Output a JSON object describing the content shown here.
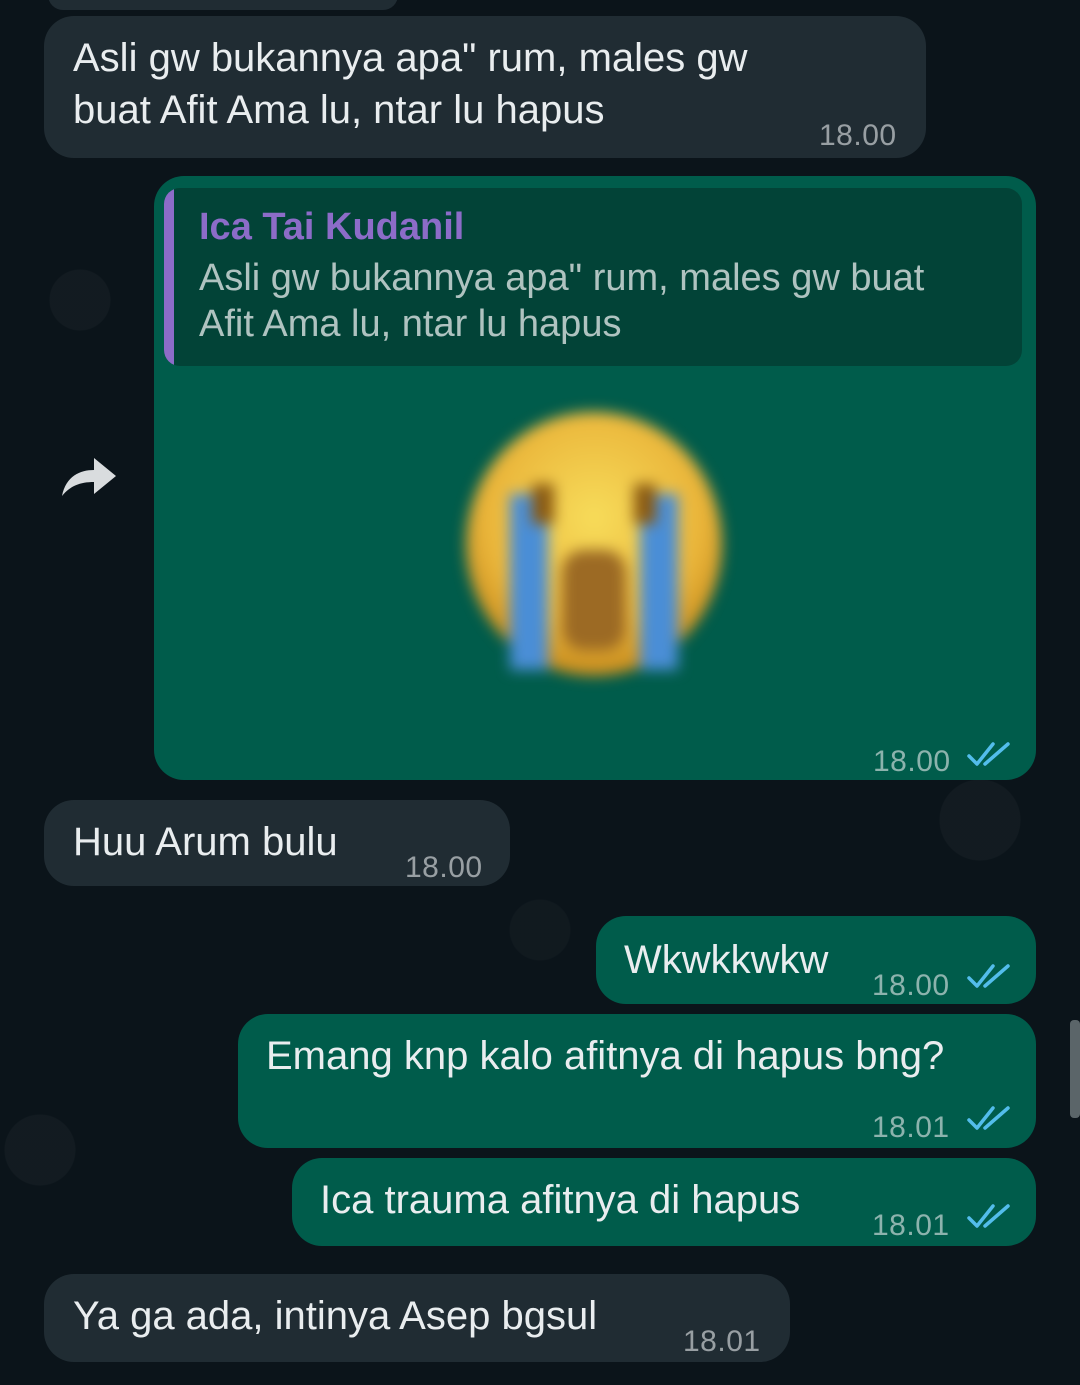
{
  "messages": [
    {
      "direction": "incoming",
      "lines": [
        "Asli gw bukannya apa\" rum, males gw",
        "buat Afit Ama lu, ntar lu hapus"
      ],
      "time": "18.00"
    },
    {
      "direction": "outgoing",
      "quote": {
        "author": "Ica Tai Kudanil",
        "lines": [
          "Asli gw bukannya apa\" rum, males gw buat",
          "Afit Ama lu, ntar lu hapus"
        ]
      },
      "sticker": "loudly-crying-face-emoji (blurred)",
      "time": "18.00",
      "status": "read"
    },
    {
      "direction": "incoming",
      "text": "Huu Arum bulu",
      "time": "18.00"
    },
    {
      "direction": "outgoing",
      "text": "Wkwkkwkw",
      "time": "18.00",
      "status": "read"
    },
    {
      "direction": "outgoing",
      "text": "Emang knp kalo afitnya di hapus bng?",
      "time": "18.01",
      "status": "read"
    },
    {
      "direction": "outgoing",
      "text": "Ica trauma afitnya di hapus",
      "time": "18.01",
      "status": "read"
    },
    {
      "direction": "incoming",
      "text": "Ya ga ada, intinya Asep bgsul",
      "time": "18.01"
    }
  ],
  "colors": {
    "background": "#0b141a",
    "incoming_bubble": "#202c33",
    "outgoing_bubble": "#005c4b",
    "quote_accent": "#8c6cc8",
    "read_ticks": "#53bdeb"
  },
  "icons": {
    "forward": "forward-arrow-icon",
    "read_receipt": "double-check-icon"
  }
}
